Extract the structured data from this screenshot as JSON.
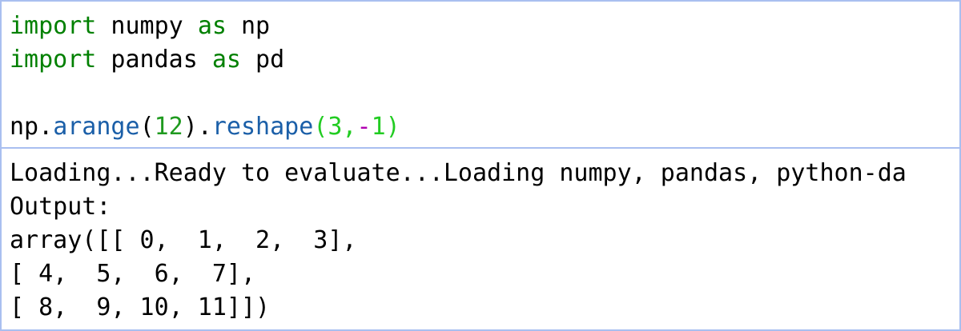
{
  "colors": {
    "keyword": "#008000",
    "function": "#1b5fa8",
    "number": "#1f9a1f",
    "args": "#22cc22",
    "operator": "#b000b0",
    "text": "#000000",
    "cell_border": "#a9bff0"
  },
  "code": {
    "line1": {
      "kw1": "import",
      "mod": " numpy ",
      "kw2": "as",
      "alias": " np"
    },
    "line2": {
      "kw1": "import",
      "mod": " pandas ",
      "kw2": "as",
      "alias": " pd"
    },
    "line4": {
      "obj": "np.",
      "fn1": "arange",
      "paren_open1": "(",
      "num": "12",
      "paren_close1": ").",
      "fn2": "reshape",
      "args_open": "(3,",
      "minus": "-",
      "args_close": "1)"
    }
  },
  "output": {
    "log": "Loading...Ready to evaluate...Loading numpy, pandas, python-da",
    "label": "Output:",
    "rows": [
      "array([[ 0,  1,  2,  3],",
      "[ 4,  5,  6,  7],",
      "[ 8,  9, 10, 11]])"
    ]
  }
}
